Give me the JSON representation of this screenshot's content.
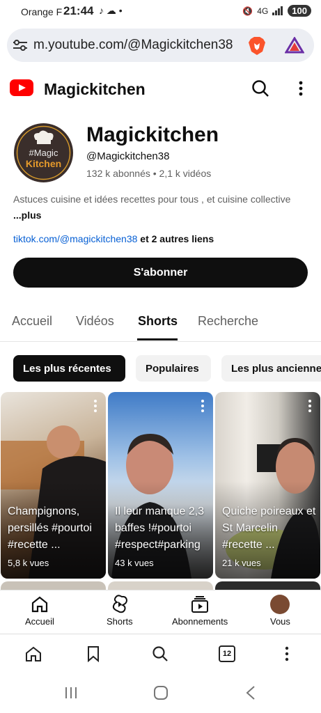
{
  "status_bar": {
    "carrier": "Orange F",
    "time": "21:44",
    "battery": "100",
    "network": "4G"
  },
  "browser": {
    "url": "m.youtube.com/@Magickitchen38",
    "tab_count": "12"
  },
  "yt_header": {
    "brand": "Magickitchen"
  },
  "channel": {
    "name": "Magickitchen",
    "handle": "@Magickitchen38",
    "stats": "132 k abonnés • 2,1 k vidéos",
    "description": "Astuces cuisine et idées recettes pour tous , et cuisine collective",
    "description_more": "...plus",
    "link": "tiktok.com/@magickitchen38",
    "other_links": "et 2 autres liens",
    "subscribe_label": "S'abonner",
    "avatar_text_1": "#Magic",
    "avatar_text_2": "Kitchen"
  },
  "tabs": [
    "Accueil",
    "Vidéos",
    "Shorts",
    "Recherche"
  ],
  "chips": [
    "Les plus récentes",
    "Populaires",
    "Les plus anciennes"
  ],
  "shorts": [
    {
      "title": "Champignons, persillés #pourtoi #recette ...",
      "views": "5,8 k vues"
    },
    {
      "title": "Il leur manque 2,3 baffes !#pourtoi #respect#parking",
      "views": "43 k vues"
    },
    {
      "title": "Quiche poireaux et St Marcelin #recette ...",
      "views": "21 k vues"
    }
  ],
  "bottom_nav": {
    "home": "Accueil",
    "shorts": "Shorts",
    "subs": "Abonnements",
    "you": "Vous"
  },
  "colors": {
    "accent": "#ff0000",
    "link": "#065fd4",
    "text": "#0f0f0f"
  },
  "icons": [
    "tune-icon",
    "brave-lion-icon",
    "triangle-rewards-icon",
    "search-icon",
    "more-vert-icon",
    "home-icon",
    "shorts-icon",
    "subscriptions-icon",
    "bookmark-icon",
    "back-icon"
  ]
}
